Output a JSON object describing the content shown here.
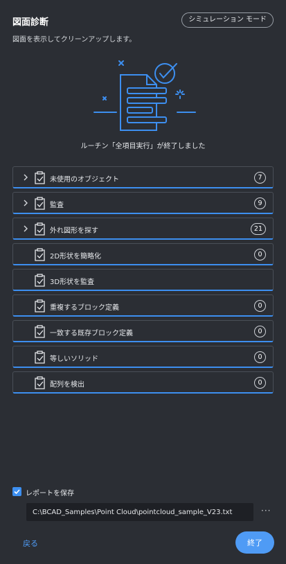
{
  "header": {
    "title": "図面診断",
    "simulation_mode_label": "シミュレーション モード"
  },
  "subtitle": "図面を表示してクリーンアップします。",
  "status_message": "ルーチン「全項目実行」が終了しました",
  "routines": [
    {
      "label": "未使用のオブジェクト",
      "count": "7",
      "expandable": true
    },
    {
      "label": "監査",
      "count": "9",
      "expandable": true
    },
    {
      "label": "外れ図形を探す",
      "count": "21",
      "expandable": true
    },
    {
      "label": "2D形状を簡略化",
      "count": "0",
      "expandable": false
    },
    {
      "label": "3D形状を監査",
      "count": "",
      "expandable": false
    },
    {
      "label": "重複するブロック定義",
      "count": "0",
      "expandable": false
    },
    {
      "label": "一致する既存ブロック定義",
      "count": "0",
      "expandable": false
    },
    {
      "label": "等しいソリッド",
      "count": "0",
      "expandable": false
    },
    {
      "label": "配列を検出",
      "count": "0",
      "expandable": false
    }
  ],
  "report": {
    "save_label": "レポートを保存",
    "save_checked": true,
    "path_value": "C:\\BCAD_Samples\\Point Cloud\\pointcloud_sample_V23.txt",
    "more_label": "···"
  },
  "footer": {
    "back_label": "戻る",
    "finish_label": "終了"
  },
  "colors": {
    "background": "#2b2e34",
    "accent": "#3d8ff0",
    "button_primary": "#4f9bf5"
  },
  "icons": {
    "illustration": "document-checked-illustration",
    "row_chevron": "chevron-right-icon",
    "row_icon": "clipboard-check-icon",
    "checkbox": "checkbox-checked-icon"
  }
}
